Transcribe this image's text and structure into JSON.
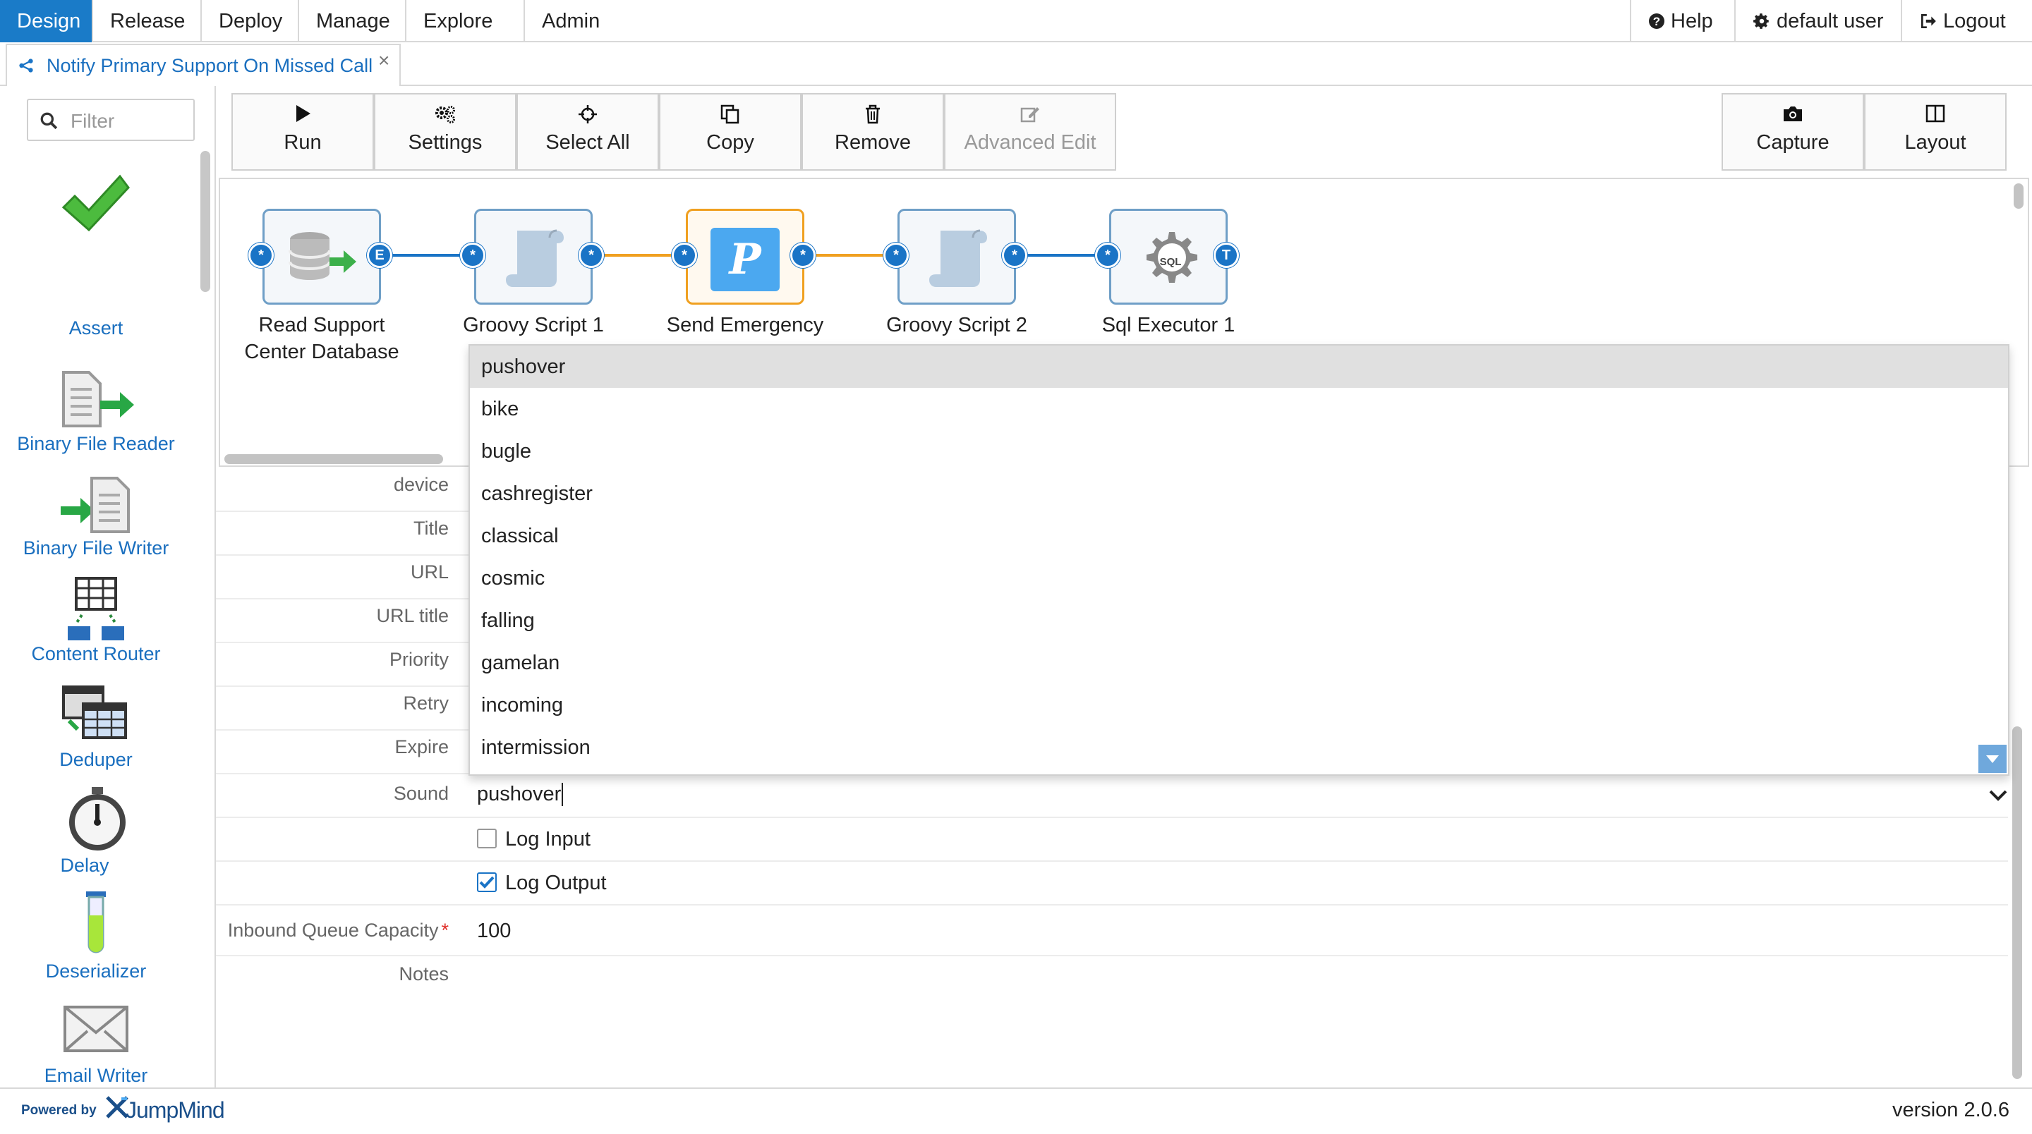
{
  "topbar": {
    "menu": [
      "Design",
      "Release",
      "Deploy",
      "Manage",
      "Explore",
      "Admin"
    ],
    "help": "Help",
    "user": "default user",
    "logout": "Logout"
  },
  "tab": {
    "title": "Notify Primary Support On Missed Call",
    "close": "×"
  },
  "palette": {
    "filter_placeholder": "Filter",
    "items": [
      "Assert",
      "Binary File Reader",
      "Binary File Writer",
      "Content Router",
      "Deduper",
      "Delay",
      "Deserializer",
      "Email Writer"
    ]
  },
  "toolbar": {
    "run": "Run",
    "settings": "Settings",
    "select_all": "Select All",
    "copy": "Copy",
    "remove": "Remove",
    "advanced_edit": "Advanced Edit",
    "capture": "Capture",
    "layout": "Layout"
  },
  "flow": {
    "nodes": [
      {
        "name": "Read Support Center Database",
        "line1": "Read Support",
        "line2": "Center Database",
        "out_port": "E"
      },
      {
        "name": "Groovy Script 1",
        "line1": "Groovy Script 1",
        "line2": ""
      },
      {
        "name": "Send Emergency",
        "line1": "Send Emergency",
        "line2": ""
      },
      {
        "name": "Groovy Script 2",
        "line1": "Groovy Script 2",
        "line2": ""
      },
      {
        "name": "Sql Executor 1",
        "line1": "Sql Executor 1",
        "line2": "",
        "out_port": "T"
      }
    ],
    "in_port_symbol": "*",
    "pushover_glyph": "P",
    "sql_glyph": "SQL",
    "colors": {
      "link_blue": "#1a74c6",
      "link_orange": "#f0a020"
    }
  },
  "properties": {
    "labels": [
      "device",
      "Title",
      "URL",
      "URL title",
      "Priority",
      "Retry",
      "Expire",
      "Sound"
    ],
    "sound_value": "pushover",
    "log_input": {
      "label": "Log Input",
      "checked": false
    },
    "log_output": {
      "label": "Log Output",
      "checked": true
    },
    "inbound_label": "Inbound Queue Capacity",
    "required_mark": "*",
    "inbound_value": "100",
    "notes_label": "Notes"
  },
  "sound_dropdown": {
    "options": [
      "pushover",
      "bike",
      "bugle",
      "cashregister",
      "classical",
      "cosmic",
      "falling",
      "gamelan",
      "incoming",
      "intermission"
    ],
    "highlighted": "pushover"
  },
  "footer": {
    "powered_by": "Powered by",
    "brand": "JumpMind",
    "version": "version 2.0.6"
  }
}
